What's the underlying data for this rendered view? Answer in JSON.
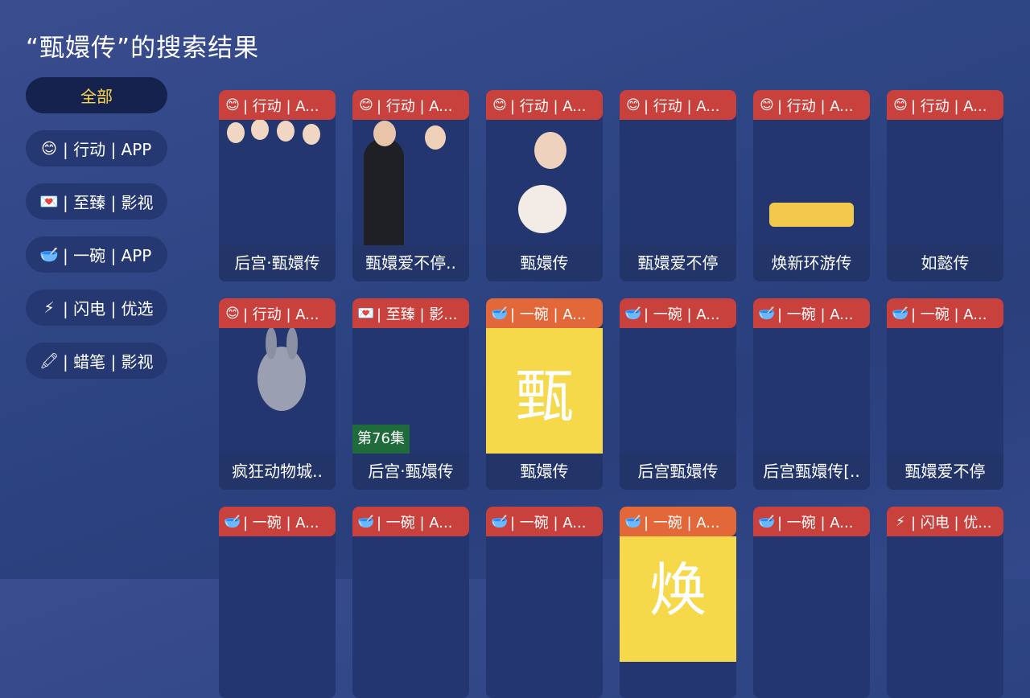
{
  "page": {
    "title": "“甄嬛传”的搜索结果"
  },
  "sidebar": {
    "items": [
      {
        "emoji": "",
        "label": "全部",
        "active": true
      },
      {
        "emoji": "😊",
        "label": "| 行动 | APP",
        "active": false
      },
      {
        "emoji": "💌",
        "label": "| 至臻 | 影视",
        "active": false
      },
      {
        "emoji": "🥣",
        "label": "| 一碗 | APP",
        "active": false
      },
      {
        "emoji": "⚡",
        "label": "| 闪电 | 优选",
        "active": false
      },
      {
        "emoji": "🖍",
        "label": "| 蜡笔 | 影视",
        "active": false
      }
    ]
  },
  "cards": [
    {
      "badge_emoji": "😊",
      "badge_text": "| 行动 | A...",
      "title": "后宫·甄嬛传"
    },
    {
      "badge_emoji": "😊",
      "badge_text": "| 行动 | A...",
      "title": "甄嬛爱不停.."
    },
    {
      "badge_emoji": "😊",
      "badge_text": "| 行动 | A...",
      "title": "甄嬛传"
    },
    {
      "badge_emoji": "😊",
      "badge_text": "| 行动 | A...",
      "title": "甄嬛爱不停"
    },
    {
      "badge_emoji": "😊",
      "badge_text": "| 行动 | A...",
      "title": "焕新环游传"
    },
    {
      "badge_emoji": "😊",
      "badge_text": "| 行动 | A...",
      "title": "如懿传"
    },
    {
      "badge_emoji": "😊",
      "badge_text": "| 行动 | A...",
      "title": "疯狂动物城.."
    },
    {
      "badge_emoji": "💌",
      "badge_text": "| 至臻 | 影...",
      "title": "后宫·甄嬛传",
      "episode": "第76集"
    },
    {
      "badge_emoji": "🥣",
      "badge_text": "| 一碗 | A...",
      "title": "甄嬛传",
      "big_char": "甄"
    },
    {
      "badge_emoji": "🥣",
      "badge_text": "| 一碗 | A...",
      "title": "后宫甄嬛传"
    },
    {
      "badge_emoji": "🥣",
      "badge_text": "| 一碗 | A...",
      "title": "后宫甄嬛传[.."
    },
    {
      "badge_emoji": "🥣",
      "badge_text": "| 一碗 | A...",
      "title": "甄嬛爱不停"
    },
    {
      "badge_emoji": "🥣",
      "badge_text": "| 一碗 | A...",
      "title": ""
    },
    {
      "badge_emoji": "🥣",
      "badge_text": "| 一碗 | A...",
      "title": ""
    },
    {
      "badge_emoji": "🥣",
      "badge_text": "| 一碗 | A...",
      "title": ""
    },
    {
      "badge_emoji": "🥣",
      "badge_text": "| 一碗 | A...",
      "title": "",
      "big_char": "焕"
    },
    {
      "badge_emoji": "🥣",
      "badge_text": "| 一碗 | A...",
      "title": ""
    },
    {
      "badge_emoji": "⚡",
      "badge_text": "| 闪电 | 优...",
      "title": ""
    }
  ],
  "colors": {
    "badge_red": "#c8413c",
    "badge_orange": "#e2683a",
    "active_text": "#ffd84a",
    "placeholder_yellow": "#f5d94b"
  }
}
